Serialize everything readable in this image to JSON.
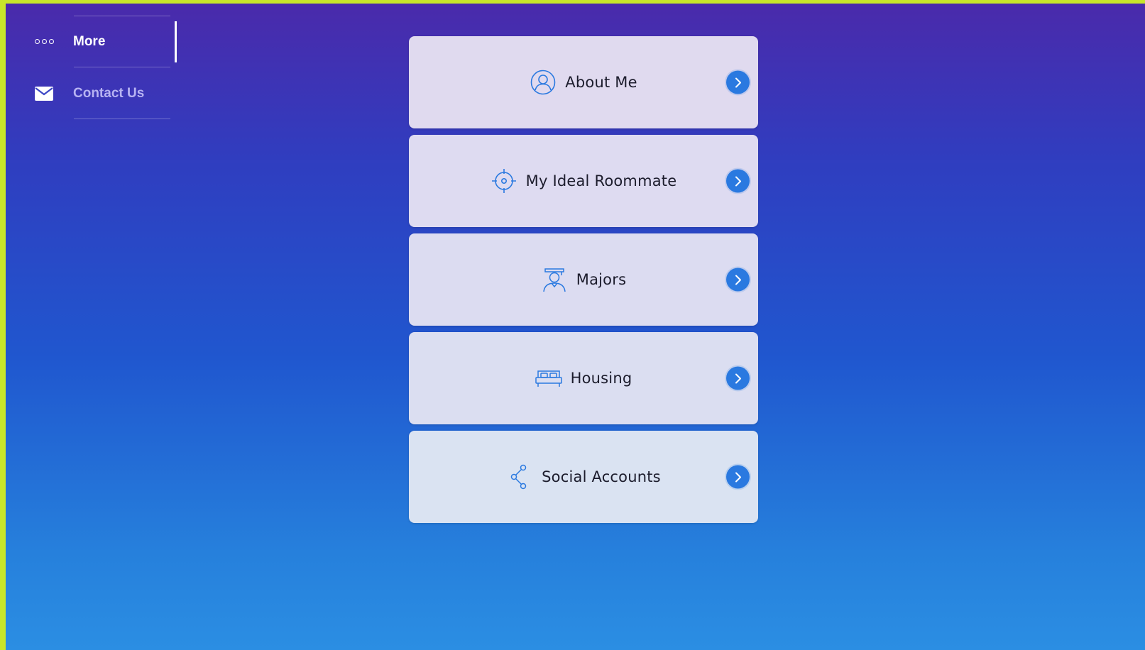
{
  "colors": {
    "frame": "#c8e62a",
    "gradient_top": "#4a2aab",
    "gradient_bottom": "#2b8ee3",
    "accent": "#2a79e0",
    "card_text": "#1c1c2c",
    "sidebar_muted": "#b7b3f2"
  },
  "sidebar": {
    "items": [
      {
        "label": "More",
        "icon": "more-dots-icon",
        "active": true
      },
      {
        "label": "Contact Us",
        "icon": "mail-icon",
        "active": false
      }
    ]
  },
  "cards": [
    {
      "label": "About Me",
      "icon": "user-circle-icon"
    },
    {
      "label": "My Ideal Roommate",
      "icon": "target-icon"
    },
    {
      "label": "Majors",
      "icon": "graduate-icon"
    },
    {
      "label": "Housing",
      "icon": "bed-icon"
    },
    {
      "label": "Social Accounts",
      "icon": "share-icon"
    }
  ]
}
